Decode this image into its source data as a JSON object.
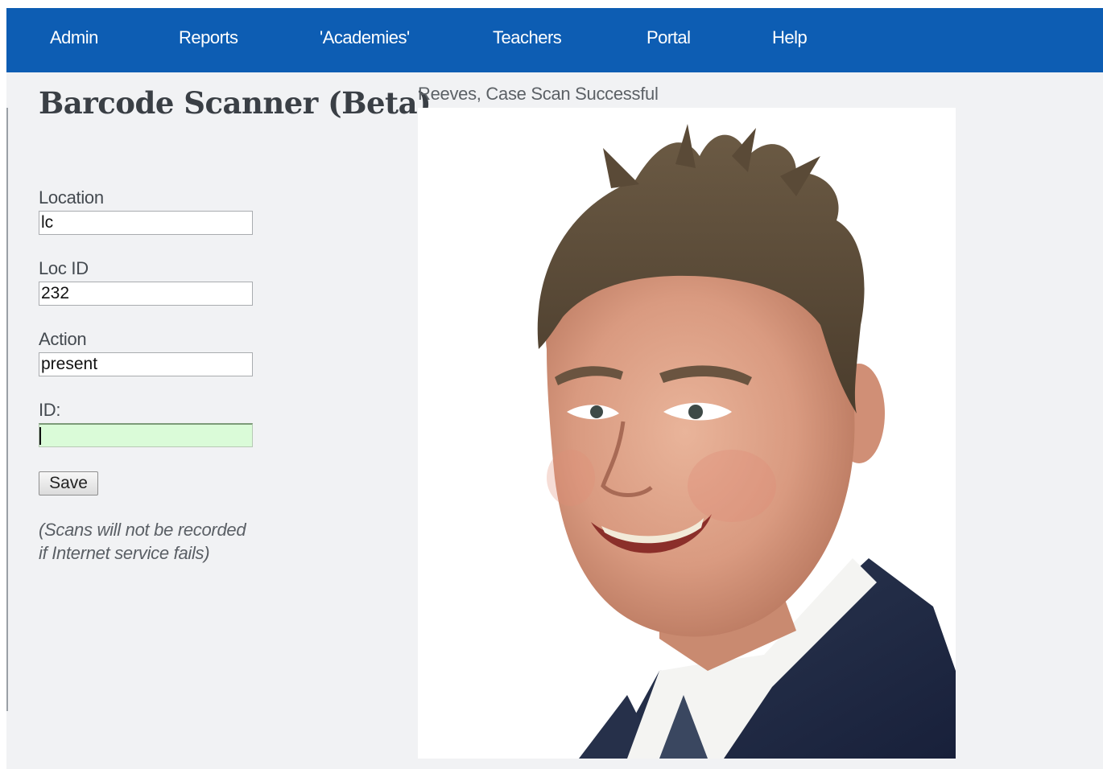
{
  "nav": {
    "items": [
      {
        "label": "Admin"
      },
      {
        "label": "Reports"
      },
      {
        "label": "'Academies'"
      },
      {
        "label": "Teachers"
      },
      {
        "label": "Portal"
      },
      {
        "label": "Help"
      }
    ]
  },
  "page": {
    "title": "Barcode Scanner (Beta)"
  },
  "form": {
    "location": {
      "label": "Location",
      "value": "lc"
    },
    "loc_id": {
      "label": "Loc ID",
      "value": "232"
    },
    "action": {
      "label": "Action",
      "value": "present"
    },
    "id": {
      "label": "ID:",
      "value": ""
    },
    "save_label": "Save",
    "note_line1": "(Scans will not be recorded",
    "note_line2": "if Internet service fails)"
  },
  "scan": {
    "status": "Reeves, Case Scan Successful"
  },
  "colors": {
    "nav_bg": "#0d5db3",
    "id_field_bg": "#dafbd8",
    "page_bg": "#f1f2f4"
  }
}
